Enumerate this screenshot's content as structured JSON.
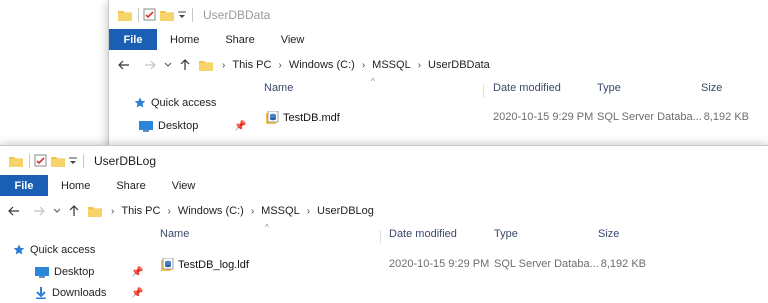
{
  "colors": {
    "accent": "#1a5fb4",
    "folder": "#f3c34b",
    "title_inactive": "#9a9a9a"
  },
  "windows": [
    {
      "title": "UserDBData",
      "ribbon": {
        "file": "File",
        "tabs": [
          "Home",
          "Share",
          "View"
        ]
      },
      "breadcrumb": [
        "This PC",
        "Windows (C:)",
        "MSSQL",
        "UserDBData"
      ],
      "columns": {
        "name": "Name",
        "date": "Date modified",
        "type": "Type",
        "size": "Size"
      },
      "navpane": [
        "Quick access",
        "Desktop"
      ],
      "files": [
        {
          "name": "TestDB.mdf",
          "date": "2020-10-15 9:29 PM",
          "type": "SQL Server Databa...",
          "size": "8,192 KB",
          "icon": "database-file-icon"
        }
      ]
    },
    {
      "title": "UserDBLog",
      "ribbon": {
        "file": "File",
        "tabs": [
          "Home",
          "Share",
          "View"
        ]
      },
      "breadcrumb": [
        "This PC",
        "Windows (C:)",
        "MSSQL",
        "UserDBLog"
      ],
      "columns": {
        "name": "Name",
        "date": "Date modified",
        "type": "Type",
        "size": "Size"
      },
      "navpane": [
        "Quick access",
        "Desktop",
        "Downloads"
      ],
      "files": [
        {
          "name": "TestDB_log.ldf",
          "date": "2020-10-15 9:29 PM",
          "type": "SQL Server Databa...",
          "size": "8,192 KB",
          "icon": "database-log-file-icon"
        }
      ]
    }
  ]
}
